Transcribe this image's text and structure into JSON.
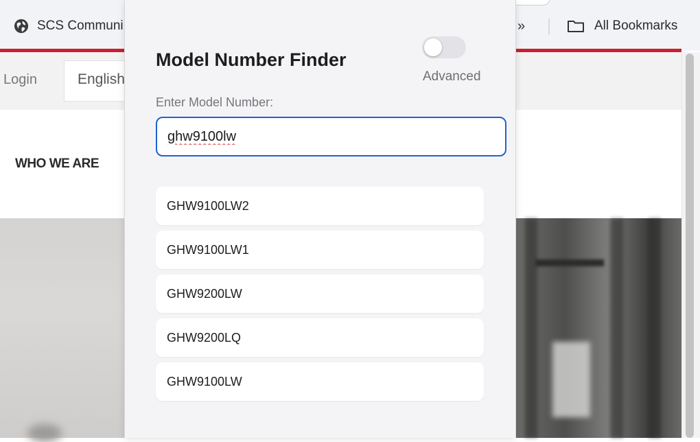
{
  "browser": {
    "bookmarks": {
      "scs_label": "SCS Communi",
      "more_label": "»",
      "all_bookmarks_label": "All Bookmarks"
    }
  },
  "website": {
    "login_label": "Login",
    "language_label": "English",
    "nav_who_we_are": "WHO WE ARE",
    "accent_color": "#c8202f"
  },
  "popup": {
    "title": "Model Number Finder",
    "advanced_toggle": {
      "label": "Advanced",
      "on": false
    },
    "input_label": "Enter Model Number:",
    "input_value": "ghw9100lw",
    "results": [
      {
        "label": "GHW9100LW2"
      },
      {
        "label": "GHW9100LW1"
      },
      {
        "label": "GHW9200LW"
      },
      {
        "label": "GHW9200LQ"
      },
      {
        "label": "GHW9100LW"
      }
    ],
    "input_focus_color": "#1f63cc"
  }
}
